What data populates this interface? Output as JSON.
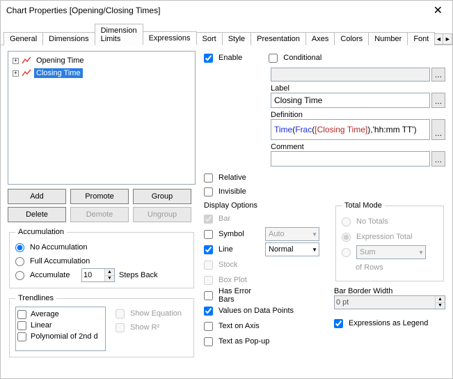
{
  "window": {
    "title": "Chart Properties [Opening/Closing Times]"
  },
  "tabs": [
    "General",
    "Dimensions",
    "Dimension Limits",
    "Expressions",
    "Sort",
    "Style",
    "Presentation",
    "Axes",
    "Colors",
    "Number",
    "Font"
  ],
  "active_tab": "Expressions",
  "expr_tree": {
    "items": [
      {
        "label": "Opening Time",
        "selected": false
      },
      {
        "label": "Closing Time",
        "selected": true
      }
    ]
  },
  "buttons": {
    "add": "Add",
    "promote": "Promote",
    "group": "Group",
    "delete": "Delete",
    "demote": "Demote",
    "ungroup": "Ungroup"
  },
  "accumulation": {
    "legend": "Accumulation",
    "no_acc": "No Accumulation",
    "full_acc": "Full Accumulation",
    "accumulate": "Accumulate",
    "steps_val": "10",
    "steps_back": "Steps Back"
  },
  "trend": {
    "legend": "Trendlines",
    "opts": [
      "Average",
      "Linear",
      "Polynomial of 2nd d"
    ],
    "show_eq": "Show Equation",
    "show_r2": "Show R²"
  },
  "right": {
    "enable": "Enable",
    "conditional": "Conditional",
    "label_lbl": "Label",
    "label_val": "Closing Time",
    "def_lbl": "Definition",
    "def_parts": {
      "time": "Time",
      "open1": "(",
      "frac": "Frac",
      "open2": "(",
      "field": "[Closing Time]",
      "close": ")",
      "fmt": ",'hh:mm TT')"
    },
    "comment_lbl": "Comment",
    "relative": "Relative",
    "invisible": "Invisible",
    "disp_opts": "Display Options",
    "bar": "Bar",
    "symbol": "Symbol",
    "symbol_val": "Auto",
    "line": "Line",
    "line_val": "Normal",
    "stock": "Stock",
    "box": "Box Plot",
    "errbars": "Has Error Bars",
    "vdp": "Values on Data Points",
    "toa": "Text on Axis",
    "tap": "Text as Pop-up"
  },
  "total_mode": {
    "legend": "Total Mode",
    "no_totals": "No Totals",
    "expr_total": "Expression Total",
    "sum": "Sum",
    "of_rows": "of Rows"
  },
  "bar_border": {
    "lbl": "Bar Border Width",
    "val": "0 pt"
  },
  "expr_legend": "Expressions as Legend",
  "chart_data": null
}
